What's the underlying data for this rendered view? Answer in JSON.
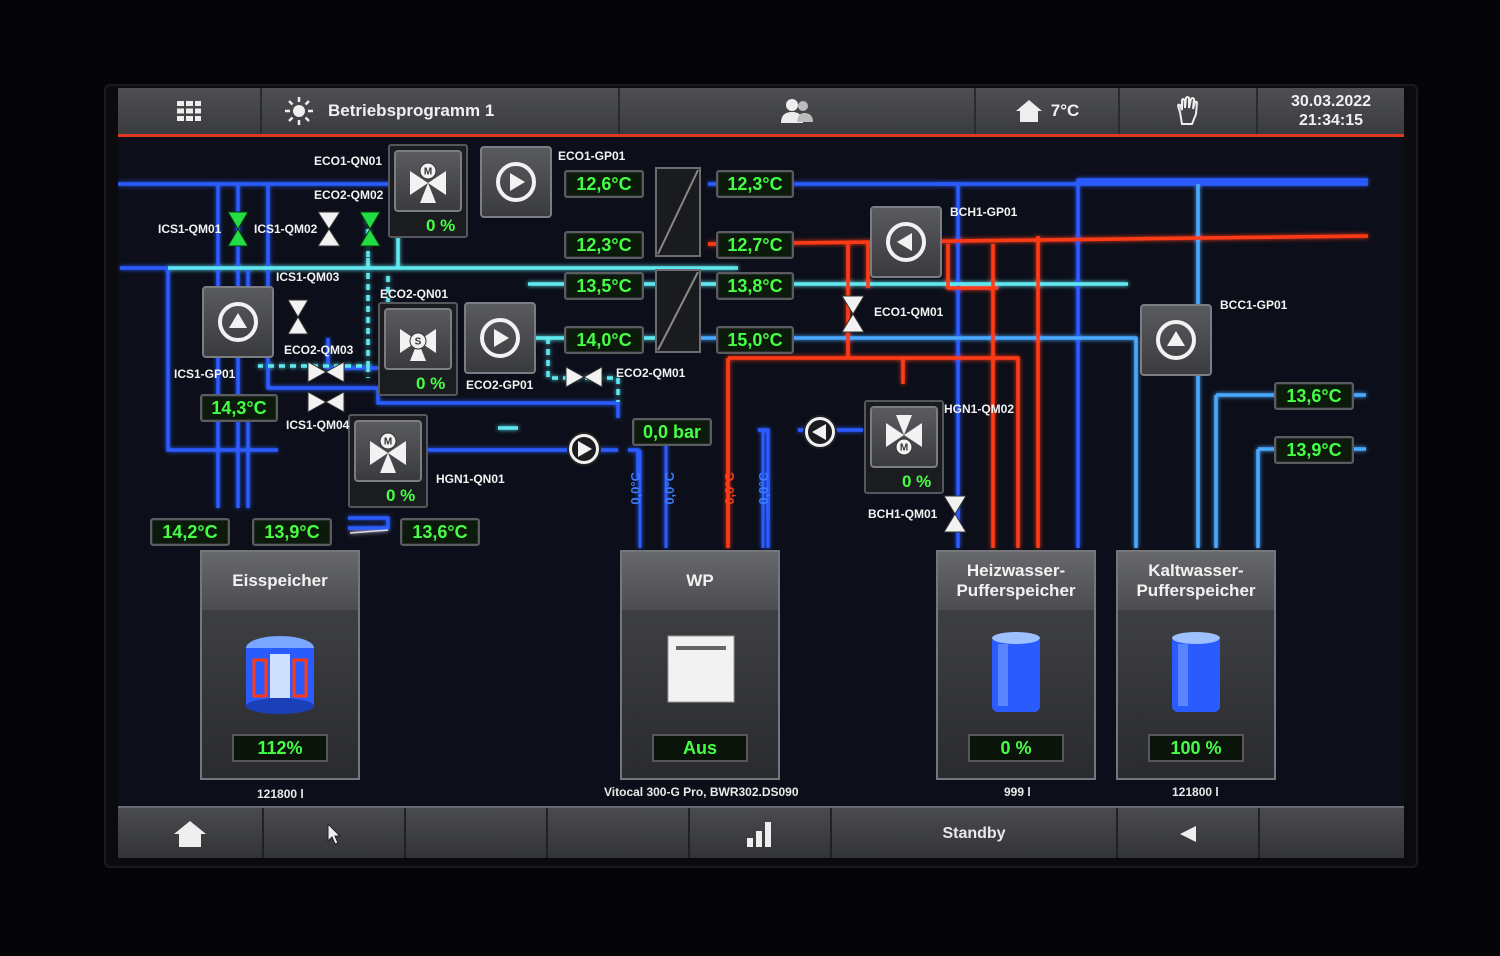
{
  "topbar": {
    "menu_icon": "grid-menu-icon",
    "program_icon": "sun-icon",
    "program": "Betriebsprogramm 1",
    "users_icon": "users-icon",
    "home_icon": "house-icon",
    "outdoor_temp": "7°C",
    "manual_icon": "hand-icon",
    "date": "30.03.2022",
    "time": "21:34:15"
  },
  "labels": {
    "eco1_qn01": "ECO1-QN01",
    "eco1_gp01": "ECO1-GP01",
    "eco2_qm02": "ECO2-QM02",
    "ics1_qm01": "ICS1-QM01",
    "ics1_qm02": "ICS1-QM02",
    "ics1_qm03": "ICS1-QM03",
    "eco2_qn01": "ECO2-QN01",
    "eco2_qm03": "ECO2-QM03",
    "ics1_gp01": "ICS1-GP01",
    "eco2_gp01": "ECO2-GP01",
    "eco2_qm01": "ECO2-QM01",
    "ics1_qm04": "ICS1-QM04",
    "hgn1_qn01": "HGN1-QN01",
    "bch1_gp01": "BCH1-GP01",
    "eco1_qm01": "ECO1-QM01",
    "hgn1_qm02": "HGN1-QM02",
    "bch1_qm01": "BCH1-QM01",
    "bcc1_gp01": "BCC1-GP01"
  },
  "values": {
    "t1": "12,6°C",
    "t2": "12,3°C",
    "t3": "12,3°C",
    "t4": "12,7°C",
    "t5": "13,5°C",
    "t6": "13,8°C",
    "t7": "14,0°C",
    "t8": "15,0°C",
    "t9": "14,3°C",
    "t10": "0,0 bar",
    "t11": "14,2°C",
    "t12": "13,9°C",
    "t13": "13,6°C",
    "t14": "13,6°C",
    "t15": "13,9°C",
    "v1": "0,0°C",
    "v2": "0,0°C",
    "v3": "0,0°C",
    "v4": "0,0°C",
    "pct_eco1": "0 %",
    "pct_eco2": "0 %",
    "pct_hgn1": "0 %",
    "pct_hgn2": "0 %"
  },
  "tanks": {
    "eis": {
      "title": "Eisspeicher",
      "value": "112%",
      "sub": "121800 l"
    },
    "wp": {
      "title": "WP",
      "value": "Aus",
      "sub": "Vitocal 300-G Pro, BWR302.DS090"
    },
    "heiz": {
      "title1": "Heizwasser-",
      "title2": "Pufferspeicher",
      "value": "0 %",
      "sub": "999 l"
    },
    "kalt": {
      "title1": "Kaltwasser-",
      "title2": "Pufferspeicher",
      "value": "100 %",
      "sub": "121800 l"
    }
  },
  "bottombar": {
    "home_icon": "house-icon",
    "cursor_icon": "cursor-icon",
    "chart_icon": "bar-chart-icon",
    "mode": "Standby",
    "back_icon": "triangle-left-icon"
  },
  "colors": {
    "cold": "#2a5bff",
    "cyan": "#5fe8f0",
    "hot": "#ff3b16",
    "lightblue": "#4aa8ff",
    "value_green": "#44ff44",
    "accent_red": "#e0391f"
  }
}
